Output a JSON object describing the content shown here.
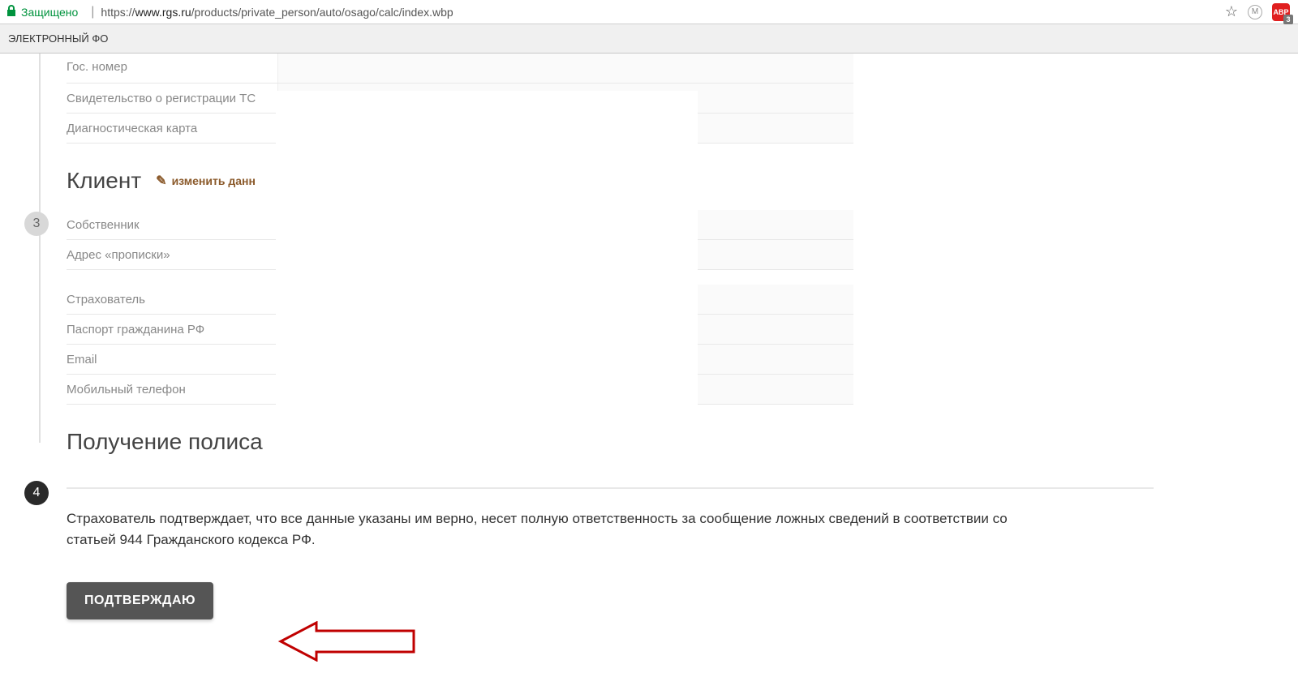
{
  "browser": {
    "secure_label": "Защищено",
    "url_prefix": "https://",
    "url_domain": "www.rgs.ru",
    "url_path": "/products/private_person/auto/osago/calc/index.wbp",
    "ext_m_label": "M",
    "ext_abp_label": "ABP",
    "ext_abp_badge": "3"
  },
  "tabs": {
    "active": "ЭЛЕКТРОННЫЙ ФО"
  },
  "steps": {
    "s3_number": "3",
    "s3_title": "Клиент",
    "s3_edit": "изменить данн",
    "s4_number": "4",
    "s4_title": "Получение полиса"
  },
  "vehicle_fields": {
    "gos_nomer": "Гос. номер",
    "sts": "Свидетельство о регистрации ТС",
    "diag": "Диагностическая карта"
  },
  "client_fields": {
    "owner": "Собственник",
    "address": "Адрес «прописки»",
    "insurer": "Страхователь",
    "passport": "Паспорт гражданина РФ",
    "email": "Email",
    "phone": "Мобильный телефон"
  },
  "confirmation": {
    "disclaimer": "Страхователь подтверждает, что все данные указаны им верно, несет полную ответственность за сообщение ложных сведений в соответствии со статьей 944 Гражданского кодекса РФ.",
    "button": "ПОДТВЕРЖДАЮ"
  }
}
